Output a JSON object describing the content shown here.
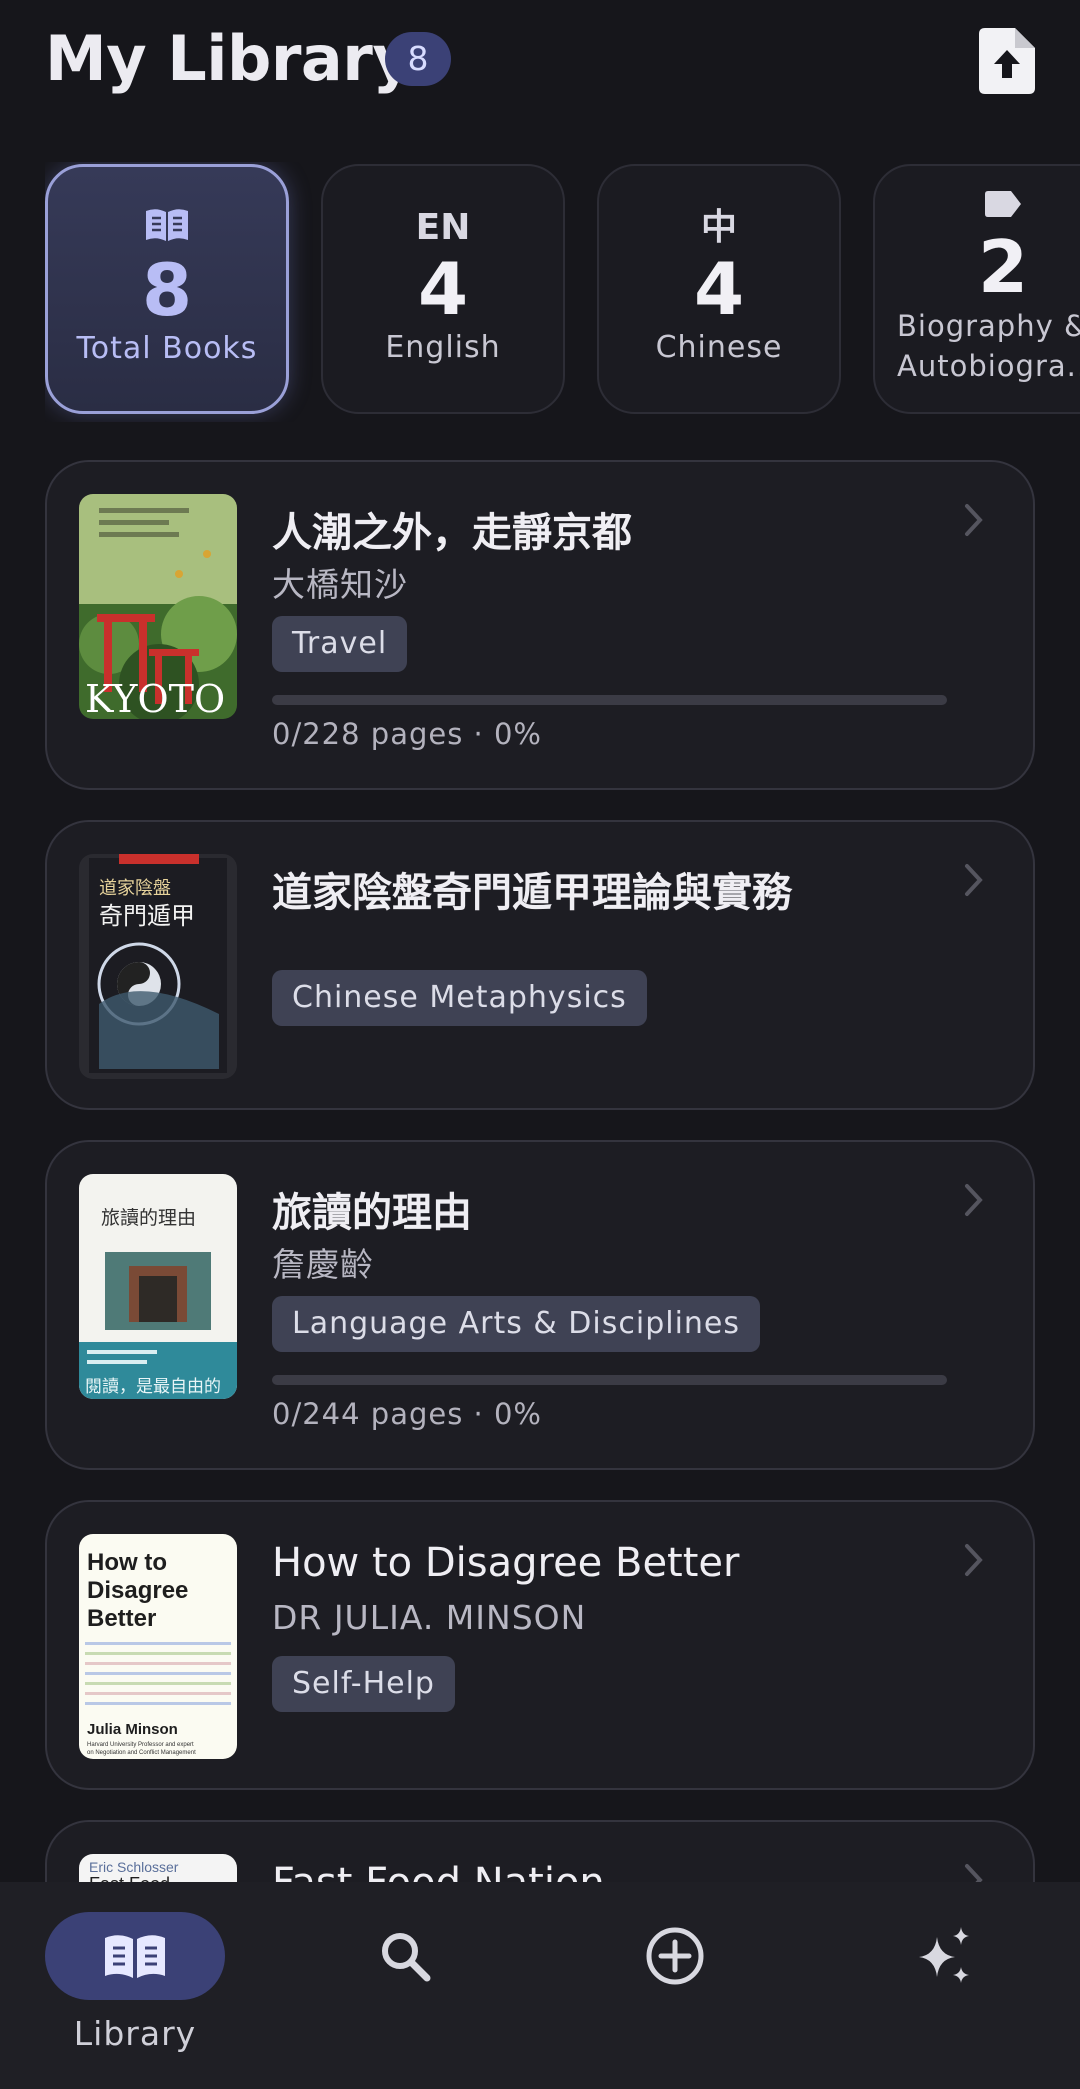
{
  "header": {
    "title": "My Library",
    "count": "8",
    "upload_icon": "file-upload-icon"
  },
  "stats": [
    {
      "icon": "open-book-icon",
      "value": "8",
      "label": "Total Books",
      "active": true
    },
    {
      "icon_text": "EN",
      "value": "4",
      "label": "English"
    },
    {
      "icon_text": "中",
      "value": "4",
      "label": "Chinese"
    },
    {
      "icon": "tag-icon",
      "value": "2",
      "label": "Biography &",
      "label2": "Autobiogra..."
    }
  ],
  "books": [
    {
      "title": "人潮之外，走靜京都",
      "author": "大橋知沙",
      "tag": "Travel",
      "progress_text": "0/228 pages · 0%",
      "progress": 0
    },
    {
      "title": "道家陰盤奇門遁甲理論與實務",
      "author": "",
      "tag": "Chinese Metaphysics"
    },
    {
      "title": "旅讀的理由",
      "author": "詹慶齡",
      "tag": "Language Arts & Disciplines",
      "progress_text": "0/244 pages · 0%",
      "progress": 0
    },
    {
      "title": "How to Disagree Better",
      "author": "DR JULIA. MINSON",
      "tag": "Self-Help"
    },
    {
      "title": "Fast Food Nation"
    }
  ],
  "covers": {
    "kyoto_text": "KYOTO",
    "qimen_text_1": "道家陰盤",
    "qimen_text_2": "奇門遁甲",
    "travel_title": "旅讀的理由",
    "travel_footer": "閱讀，是最自由的",
    "disagree_line1": "How to",
    "disagree_line2": "Disagree",
    "disagree_line3": "Better",
    "disagree_author": "Julia Minson",
    "disagree_sub1": "Harvard University Professor and expert",
    "disagree_sub2": "on Negotiation and Conflict Management",
    "fastfood_author": "Eric Schlosser",
    "fastfood_title": "Fast Food"
  },
  "nav": {
    "library_label": "Library"
  },
  "colors": {
    "accent": "#3b4176",
    "background": "#16161b",
    "card": "#1d1d23"
  }
}
